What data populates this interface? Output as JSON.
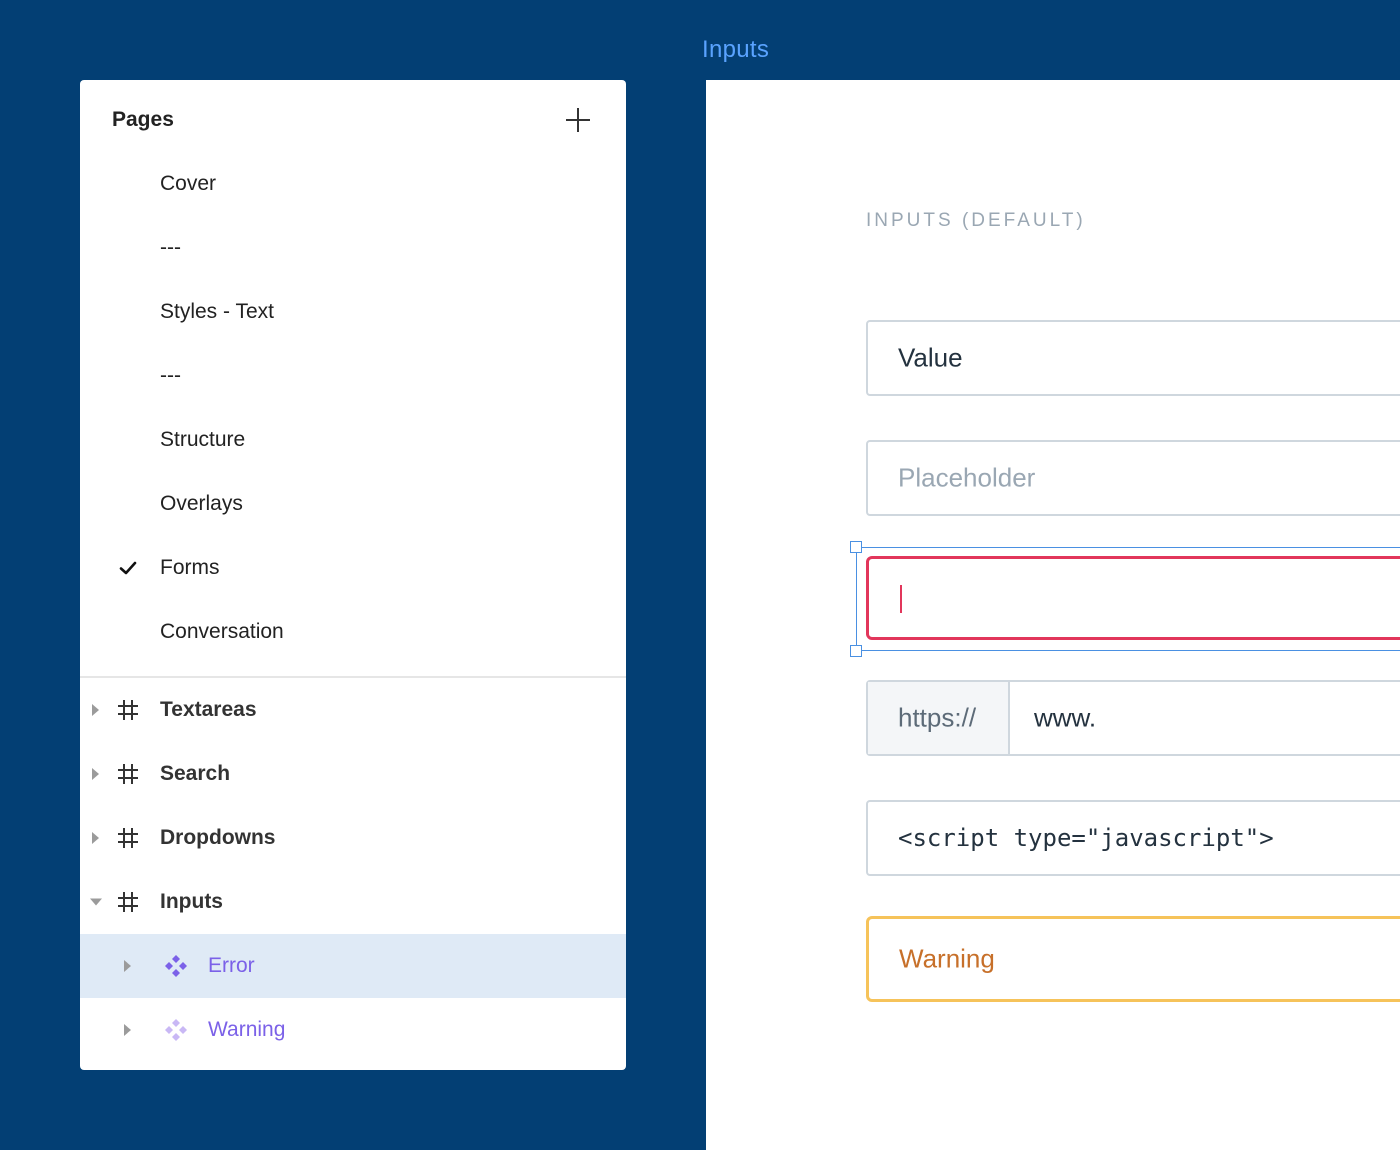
{
  "frame_label": "Inputs",
  "sidebar": {
    "title": "Pages",
    "add_icon": "plus-icon",
    "pages": [
      {
        "label": "Cover",
        "checked": false
      },
      {
        "label": "---",
        "checked": false
      },
      {
        "label": "Styles - Text",
        "checked": false
      },
      {
        "label": "---",
        "checked": false
      },
      {
        "label": "Structure",
        "checked": false
      },
      {
        "label": "Overlays",
        "checked": false
      },
      {
        "label": "Forms",
        "checked": true
      },
      {
        "label": "Conversation",
        "checked": false
      }
    ],
    "layers": [
      {
        "label": "Textareas",
        "type": "frame",
        "icon": "frame-icon",
        "expanded": false
      },
      {
        "label": "Search",
        "type": "frame",
        "icon": "frame-icon",
        "expanded": false
      },
      {
        "label": "Dropdowns",
        "type": "frame",
        "icon": "frame-icon",
        "expanded": false
      },
      {
        "label": "Inputs",
        "type": "frame",
        "icon": "frame-icon",
        "expanded": true
      },
      {
        "label": "Error",
        "type": "component",
        "icon": "component-icon",
        "selected": true
      },
      {
        "label": "Warning",
        "type": "component",
        "icon": "component-icon",
        "selected": false
      }
    ]
  },
  "canvas": {
    "section_title": "INPUTS (DEFAULT)",
    "fields": {
      "value": "Value",
      "placeholder": "Placeholder",
      "url_prefix": "https://",
      "url_value": "www.",
      "code": "<script type=\"javascript\">",
      "warning": "Warning"
    }
  },
  "colors": {
    "background": "#033f74",
    "accent_label": "#5aa3ff",
    "error_border": "#e2365b",
    "warning_border": "#f6c35a",
    "warning_text": "#c7702a",
    "component_purple": "#7b61e8",
    "selection_blue": "#4a90e2",
    "selected_row": "#dfeaf6"
  }
}
